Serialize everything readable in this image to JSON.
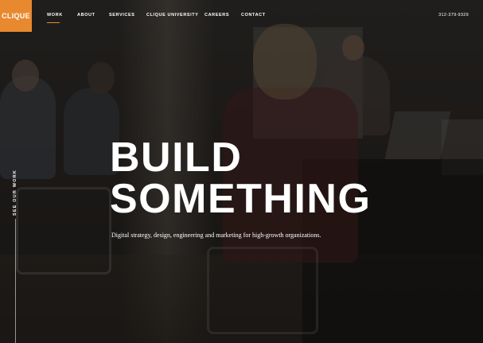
{
  "brand": {
    "logo_text": "CLIQUE",
    "accent": "#e8892f"
  },
  "nav": {
    "items": [
      {
        "label": "WORK",
        "active": true
      },
      {
        "label": "ABOUT",
        "active": false
      },
      {
        "label": "SERVICES",
        "active": false
      },
      {
        "label": "CLIQUE UNIVERSITY",
        "active": false
      },
      {
        "label": "CAREERS",
        "active": false
      },
      {
        "label": "CONTACT",
        "active": false
      }
    ],
    "phone": "312-379-9329"
  },
  "side": {
    "label": "SEE OUR WORK"
  },
  "hero": {
    "headline_line1": "BUILD",
    "headline_line2": "SOMETHING",
    "subheadline": "Digital strategy, design, engineering and marketing for high-growth organizations."
  }
}
